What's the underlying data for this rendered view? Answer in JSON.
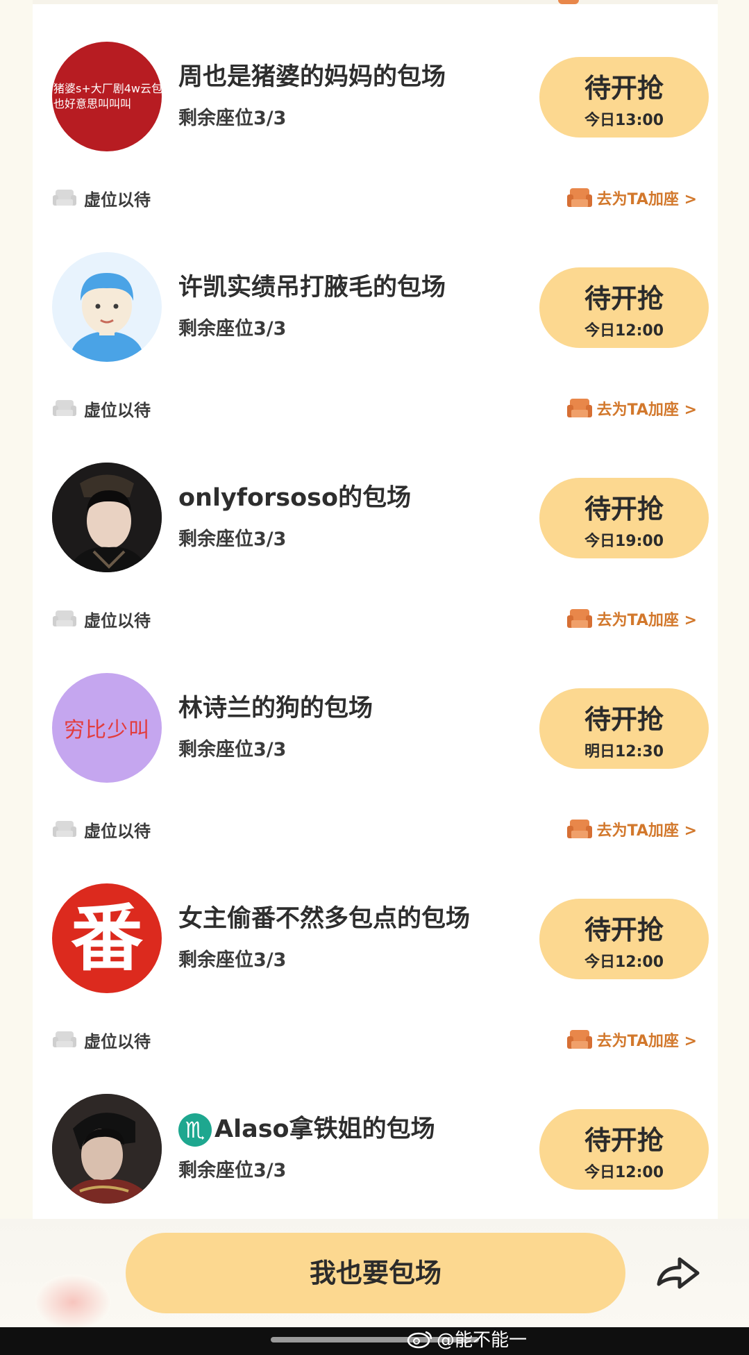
{
  "items": [
    {
      "title": "周也是猪婆的妈妈的包场",
      "seats": "剩余座位3/3",
      "button_label": "待开抢",
      "button_time": "今日13:00",
      "virtual_text": "虚位以待",
      "join_text": "去为TA加座 >",
      "avatar_lines": [
        "猪婆s+大厂剧4w云包",
        "也好意思叫叫叫"
      ],
      "avatar_color": "#b71c22"
    },
    {
      "title": "许凯实绩吊打腋毛的包场",
      "seats": "剩余座位3/3",
      "button_label": "待开抢",
      "button_time": "今日12:00",
      "virtual_text": "虚位以待",
      "join_text": "去为TA加座 >",
      "avatar_color": "#e8f3fd"
    },
    {
      "title": "onlyforsoso的包场",
      "seats": "剩余座位3/3",
      "button_label": "待开抢",
      "button_time": "今日19:00",
      "virtual_text": "虚位以待",
      "join_text": "去为TA加座 >",
      "avatar_color": "#1a1a1a"
    },
    {
      "title": "林诗兰的狗的包场",
      "seats": "剩余座位3/3",
      "button_label": "待开抢",
      "button_time": "明日12:30",
      "virtual_text": "虚位以待",
      "join_text": "去为TA加座 >",
      "avatar_text": "穷比少叫",
      "avatar_color": "#c5a6ef"
    },
    {
      "title": "女主偷番不然多包点的包场",
      "seats": "剩余座位3/3",
      "button_label": "待开抢",
      "button_time": "今日12:00",
      "virtual_text": "虚位以待",
      "join_text": "去为TA加座 >",
      "avatar_text": "番",
      "avatar_color": "#dc2a1e"
    },
    {
      "title_prefix_icon": "♏",
      "title": "Alaso拿铁姐的包场",
      "seats": "剩余座位3/3",
      "button_label": "待开抢",
      "button_time": "今日12:00",
      "avatar_color": "#2a2422"
    }
  ],
  "bottom": {
    "cta_label": "我也要包场",
    "share_icon": "share-arrow-icon"
  },
  "watermark": "@能不能一",
  "colors": {
    "button_bg": "#fcd890",
    "join_text": "#d2782c",
    "page_bg": "#fbf9ef"
  }
}
